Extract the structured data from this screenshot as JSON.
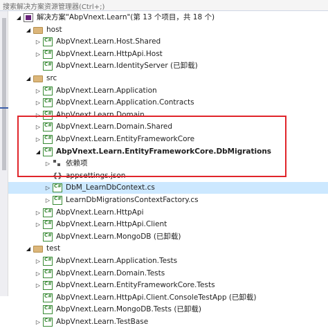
{
  "search": {
    "placeholder": "搜索解决方案资源管理器(Ctrl+;)"
  },
  "tree": [
    {
      "key": "solution",
      "label": "解决方案\"AbpVnext.Learn\"(第 13 个项目，共 18 个)",
      "icon": "solution-icon",
      "arrow": "expanded",
      "indent": 0
    },
    {
      "key": "folder-host",
      "label": "host",
      "icon": "folder-icon",
      "arrow": "expanded",
      "indent": 1
    },
    {
      "key": "host-shared",
      "label": "AbpVnext.Learn.Host.Shared",
      "icon": "csharp-project-icon",
      "arrow": "collapsed",
      "indent": 2
    },
    {
      "key": "httpapi-host",
      "label": "AbpVnext.Learn.HttpApi.Host",
      "icon": "csharp-project-icon",
      "arrow": "collapsed",
      "indent": 2
    },
    {
      "key": "identityserver",
      "label": "AbpVnext.Learn.IdentityServer (已卸载)",
      "icon": "csharp-project-icon",
      "arrow": "none",
      "indent": 2
    },
    {
      "key": "folder-src",
      "label": "src",
      "icon": "folder-icon",
      "arrow": "expanded",
      "indent": 1
    },
    {
      "key": "application",
      "label": "AbpVnext.Learn.Application",
      "icon": "csharp-project-icon",
      "arrow": "collapsed",
      "indent": 2
    },
    {
      "key": "application-contracts",
      "label": "AbpVnext.Learn.Application.Contracts",
      "icon": "csharp-project-icon",
      "arrow": "collapsed",
      "indent": 2
    },
    {
      "key": "domain",
      "label": "AbpVnext.Learn.Domain",
      "icon": "csharp-project-icon",
      "arrow": "collapsed",
      "indent": 2
    },
    {
      "key": "domain-shared",
      "label": "AbpVnext.Learn.Domain.Shared",
      "icon": "csharp-project-icon",
      "arrow": "collapsed",
      "indent": 2
    },
    {
      "key": "efcore",
      "label": "AbpVnext.Learn.EntityFrameworkCore",
      "icon": "csharp-project-icon",
      "arrow": "collapsed",
      "indent": 2
    },
    {
      "key": "dbmigrations",
      "label": "AbpVnext.Learn.EntityFrameworkCore.DbMigrations",
      "icon": "csharp-project-icon",
      "arrow": "expanded",
      "indent": 2,
      "bold": true
    },
    {
      "key": "deps",
      "label": "依赖项",
      "icon": "dependencies-icon",
      "arrow": "collapsed",
      "indent": 3
    },
    {
      "key": "appsettings",
      "label": "appsettings.json",
      "icon": "json-file-icon",
      "arrow": "none",
      "indent": 3
    },
    {
      "key": "dbcontext",
      "label": "DbM_LearnDbContext.cs",
      "icon": "csharp-file-icon",
      "arrow": "collapsed",
      "indent": 3,
      "selected": true
    },
    {
      "key": "factory",
      "label": "LearnDbMigrationsContextFactory.cs",
      "icon": "csharp-file-icon",
      "arrow": "collapsed",
      "indent": 3
    },
    {
      "key": "httpapi",
      "label": "AbpVnext.Learn.HttpApi",
      "icon": "csharp-project-icon",
      "arrow": "collapsed",
      "indent": 2
    },
    {
      "key": "httpapi-client",
      "label": "AbpVnext.Learn.HttpApi.Client",
      "icon": "csharp-project-icon",
      "arrow": "collapsed",
      "indent": 2
    },
    {
      "key": "mongodb",
      "label": "AbpVnext.Learn.MongoDB (已卸载)",
      "icon": "csharp-project-icon",
      "arrow": "none",
      "indent": 2
    },
    {
      "key": "folder-test",
      "label": "test",
      "icon": "folder-icon",
      "arrow": "expanded",
      "indent": 1
    },
    {
      "key": "application-tests",
      "label": "AbpVnext.Learn.Application.Tests",
      "icon": "csharp-project-icon",
      "arrow": "collapsed",
      "indent": 2
    },
    {
      "key": "domain-tests",
      "label": "AbpVnext.Learn.Domain.Tests",
      "icon": "csharp-project-icon",
      "arrow": "collapsed",
      "indent": 2
    },
    {
      "key": "efcore-tests",
      "label": "AbpVnext.Learn.EntityFrameworkCore.Tests",
      "icon": "csharp-project-icon",
      "arrow": "collapsed",
      "indent": 2
    },
    {
      "key": "console-testapp",
      "label": "AbpVnext.Learn.HttpApi.Client.ConsoleTestApp (已卸载)",
      "icon": "csharp-project-icon",
      "arrow": "none",
      "indent": 2
    },
    {
      "key": "mongodb-tests",
      "label": "AbpVnext.Learn.MongoDB.Tests (已卸载)",
      "icon": "csharp-project-icon",
      "arrow": "none",
      "indent": 2
    },
    {
      "key": "testbase",
      "label": "AbpVnext.Learn.TestBase",
      "icon": "csharp-project-icon",
      "arrow": "collapsed",
      "indent": 2
    }
  ]
}
